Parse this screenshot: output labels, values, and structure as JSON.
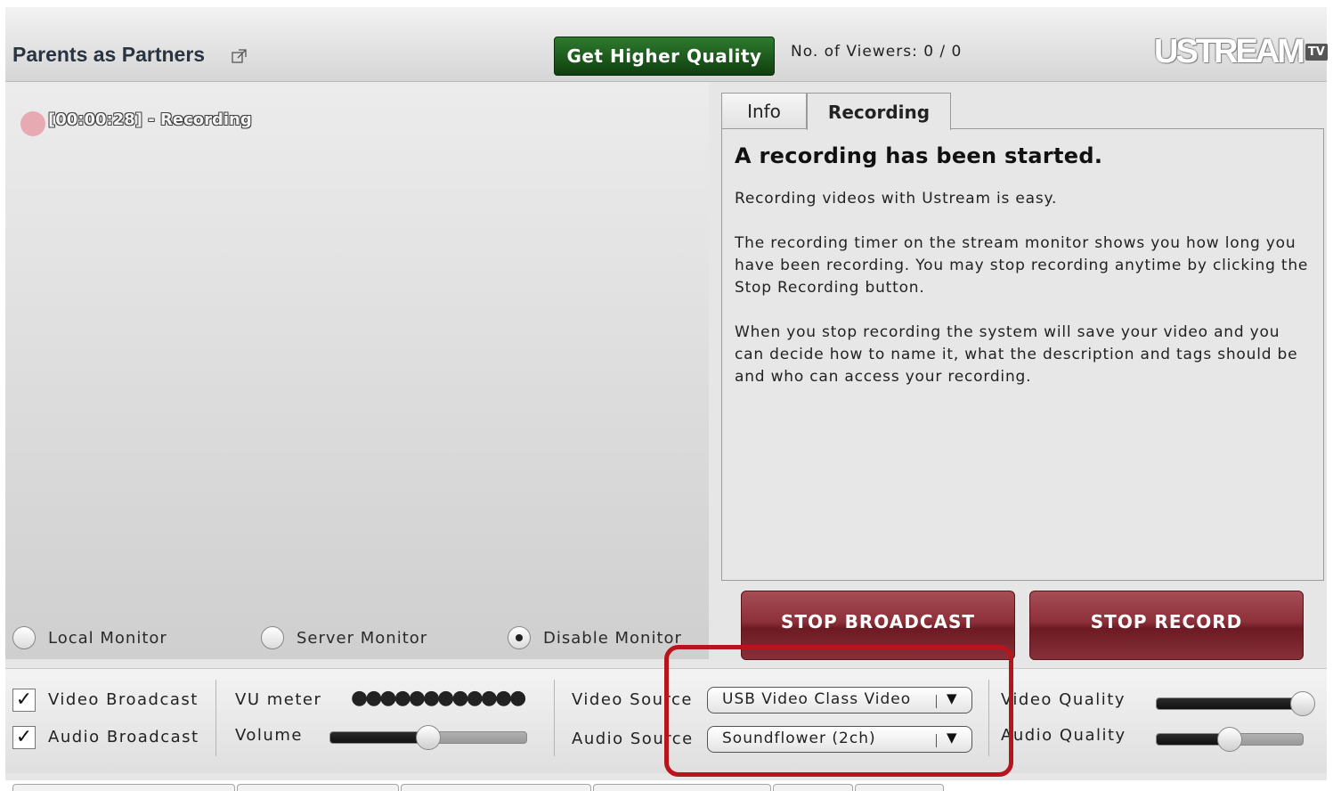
{
  "header": {
    "title": "Parents as Partners",
    "hq_button": "Get Higher Quality",
    "viewers": "No. of Viewers: 0 / 0",
    "logo_main": "USTREAM",
    "logo_suffix": "TV"
  },
  "video": {
    "recording_label": "[00:00:28] - Recording",
    "monitor_options": [
      {
        "label": "Local Monitor",
        "selected": false
      },
      {
        "label": "Server Monitor",
        "selected": false
      },
      {
        "label": "Disable Monitor",
        "selected": true
      }
    ]
  },
  "panel": {
    "tabs": [
      {
        "label": "Info",
        "active": false
      },
      {
        "label": "Recording",
        "active": true
      }
    ],
    "heading": "A recording has been started.",
    "paragraphs": [
      "Recording videos with Ustream is easy.",
      "The recording timer on the stream monitor shows you how long you have been recording. You may stop recording anytime by clicking the Stop Recording button.",
      "When you stop recording the system will save your video and you can decide how to name it, what the description and tags should be and who can access your recording."
    ]
  },
  "buttons": {
    "stop_broadcast": "STOP BROADCAST",
    "stop_record": "STOP RECORD"
  },
  "controls": {
    "video_broadcast": {
      "label": "Video Broadcast",
      "checked": true
    },
    "audio_broadcast": {
      "label": "Audio Broadcast",
      "checked": true
    },
    "vu_meter_label": "VU meter",
    "vu_meter_dots": "●●●●●●●●●●●●",
    "volume_label": "Volume",
    "volume_level": 0.5,
    "video_source_label": "Video Source",
    "video_source_value": "USB Video Class Video",
    "audio_source_label": "Audio Source",
    "audio_source_value": "Soundflower (2ch)",
    "video_quality_label": "Video Quality",
    "video_quality_level": 1.0,
    "audio_quality_label": "Audio Quality",
    "audio_quality_level": 0.5,
    "check_glyph": "✓",
    "dropdown_arrow": "▼"
  },
  "colors": {
    "hq_button": "#1f5a1f",
    "stop_buttons": "#8c3039",
    "highlight": "#b8141c",
    "rec_dot": "#e8aab2"
  }
}
